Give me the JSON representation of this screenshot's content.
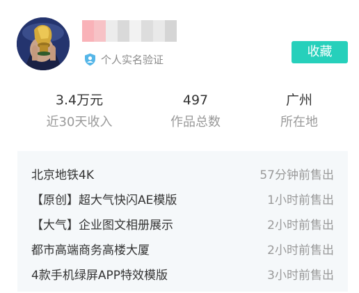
{
  "profile": {
    "avatar_icon": "avatar-photo-trophy",
    "verify_icon": "person-shield-icon",
    "verify_label": "个人实名验证",
    "collect_button": "收藏",
    "accent_color": "#26d0bb",
    "name_mosaic_colors": [
      "#f9b2b8",
      "#f7c2c6",
      "#ececec",
      "#d9d9d9",
      "#f2f2f2",
      "#dddddd",
      "#e9e9e9",
      "#d5d5d5"
    ]
  },
  "stats": [
    {
      "value": "3.4万元",
      "label": "近30天收入"
    },
    {
      "value": "497",
      "label": "作品总数"
    },
    {
      "value": "广州",
      "label": "所在地"
    }
  ],
  "recent_sales": [
    {
      "title": "北京地铁4K",
      "time": "57分钟前售出"
    },
    {
      "title": "【原创】超大气快闪AE模版",
      "time": "1小时前售出"
    },
    {
      "title": "【大气】企业图文相册展示",
      "time": "2小时前售出"
    },
    {
      "title": "都市高端商务高楼大厦",
      "time": "2小时前售出"
    },
    {
      "title": "4款手机绿屏APP特效模版",
      "time": "3小时前售出"
    }
  ]
}
